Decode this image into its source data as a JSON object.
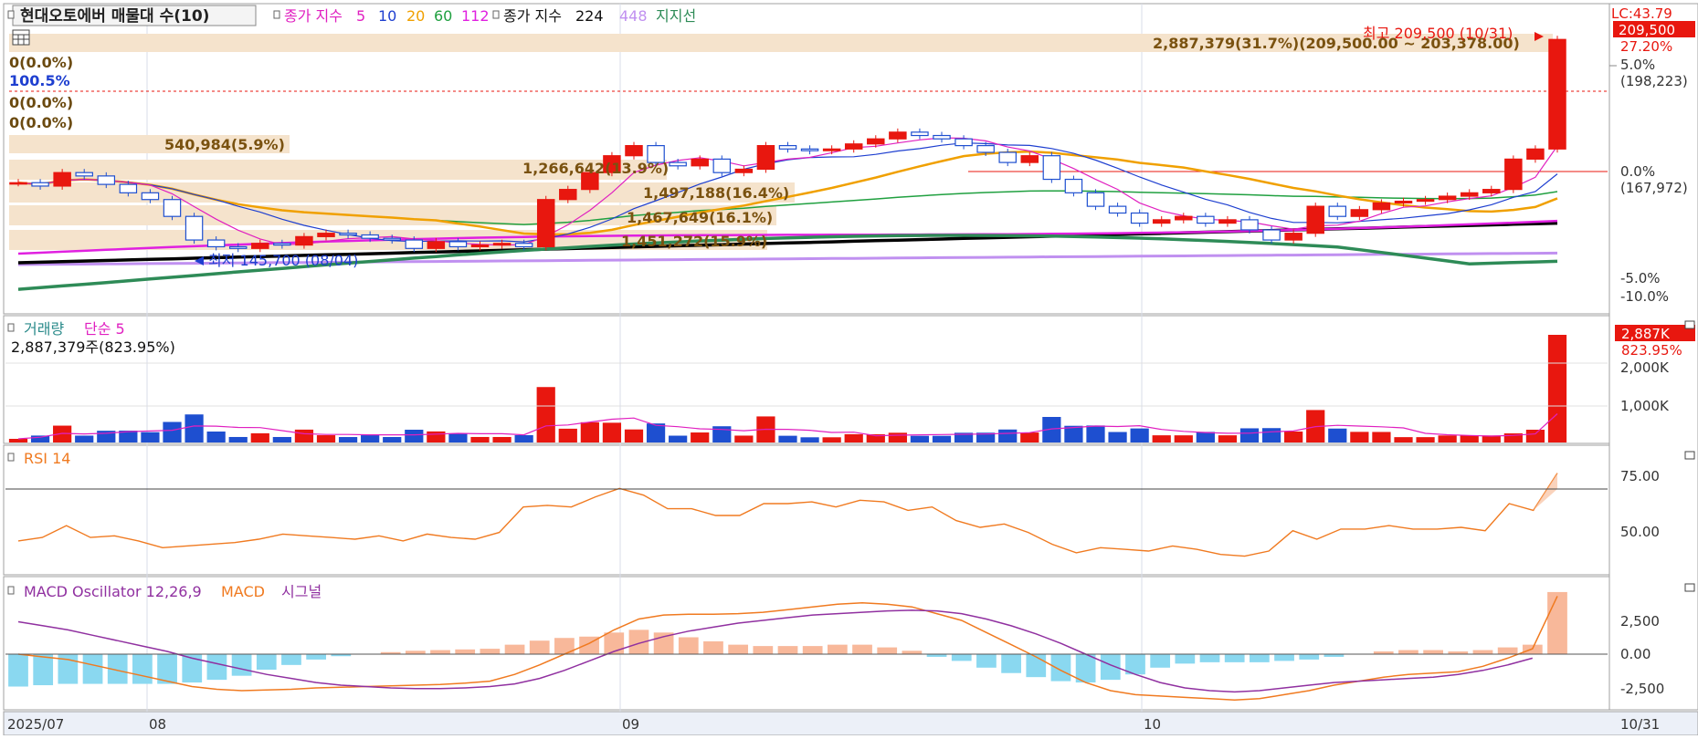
{
  "header": {
    "stock_label": "현대오토에버 매물대 수(10)",
    "close_index_label": "종가 지수",
    "ma_periods": [
      "5",
      "10",
      "20",
      "60",
      "112"
    ],
    "close_index2_label": "종가 지수",
    "ma_long_periods": [
      "224",
      "448"
    ],
    "support_label": "지지선"
  },
  "price_panel": {
    "lc_label": "LC:43.79",
    "current_price_badge": "209,500",
    "change_pct": "27.20%",
    "right_axis": [
      "5.0%",
      "(198,223)",
      "0.0%",
      "(167,972)",
      "-5.0%",
      "-10.0%"
    ],
    "high_marker": "최고 209,500 (10/31)",
    "low_marker": "최저 145,700 (08/04)",
    "zero_rows": [
      "0(0.0%)",
      "100.5%",
      "0(0.0%)",
      "0(0.0%)"
    ],
    "volume_profile_labels": [
      "2,887,379(31.7%)(209,500.00 ~ 203,378.00)",
      "540,984(5.9%)",
      "1,266,642(13.9%)",
      "1,497,188(16.4%)",
      "1,467,649(16.1%)",
      "1,451,272(15.9%)"
    ]
  },
  "volume_panel": {
    "title": "거래량",
    "ma_label": "단순 5",
    "current_volume": "2,887,379주(823.95%)",
    "badge_value": "2,887K",
    "badge_pct": "823.95%",
    "axis": [
      "2,000K",
      "1,000K"
    ]
  },
  "rsi_panel": {
    "title": "RSI 14",
    "axis": [
      "75.00",
      "50.00"
    ]
  },
  "macd_panel": {
    "osc_label": "MACD Oscillator 12,26,9",
    "macd_label": "MACD",
    "signal_label": "시그널",
    "axis": [
      "2,500",
      "0.00",
      "-2,500"
    ]
  },
  "xaxis": {
    "labels": [
      "2025/07",
      "08",
      "09",
      "10",
      "10/31"
    ]
  },
  "colors": {
    "up": "#e8170f",
    "down": "#1e4fd0",
    "ma5": "#e020c0",
    "ma10": "#1e3fd0",
    "ma20": "#f0a000",
    "ma60": "#20a040",
    "ma112": "#e020e0",
    "ma224": "#000000",
    "ma448": "#c090f0",
    "support": "#2e8b57",
    "rsi": "#f07a20",
    "macd": "#f07a20",
    "signal": "#9030a0",
    "osc_pos": "#f8b89a",
    "osc_neg": "#8ad8f0",
    "profile": "#f5e3cc"
  },
  "chart_data": {
    "type": "candlestick",
    "description_series": "daily candles Jul–Oct 2025",
    "closes": [
      167000,
      166000,
      170000,
      169000,
      166500,
      164000,
      162000,
      157000,
      150000,
      148000,
      147500,
      149000,
      148500,
      151000,
      152000,
      151500,
      150500,
      150000,
      147500,
      149500,
      148000,
      148500,
      149000,
      148000,
      162000,
      165000,
      170000,
      175000,
      178000,
      173000,
      172000,
      174000,
      170000,
      171000,
      178000,
      177000,
      176500,
      177000,
      178500,
      180000,
      182000,
      181000,
      180000,
      178000,
      176000,
      173000,
      175000,
      168000,
      164000,
      160000,
      158000,
      155000,
      156000,
      157000,
      155000,
      156000,
      153000,
      150000,
      152000,
      160000,
      157000,
      159000,
      161000,
      161500,
      162000,
      163000,
      164000,
      165000,
      174000,
      177000,
      209500
    ],
    "rsi": [
      40,
      42,
      49,
      42,
      43,
      40,
      36,
      37,
      38,
      39,
      41,
      44,
      43,
      42,
      41,
      43,
      40,
      44,
      42,
      41,
      45,
      60,
      61,
      60,
      66,
      71,
      67,
      59,
      59,
      55,
      55,
      62,
      62,
      63,
      60,
      64,
      63,
      58,
      60,
      52,
      48,
      50,
      45,
      38,
      33,
      36,
      35,
      34,
      37,
      35,
      32,
      31,
      34,
      46,
      41,
      47,
      47,
      49,
      47,
      47,
      48,
      46,
      62,
      58,
      80
    ],
    "macd": [
      0,
      -200,
      -400,
      -800,
      -1200,
      -1600,
      -2000,
      -2400,
      -2600,
      -2700,
      -2650,
      -2600,
      -2500,
      -2450,
      -2400,
      -2350,
      -2300,
      -2250,
      -2150,
      -2000,
      -1500,
      -800,
      0,
      800,
      1800,
      2600,
      2900,
      2950,
      2950,
      3000,
      3100,
      3300,
      3500,
      3700,
      3800,
      3700,
      3500,
      3000,
      2500,
      1600,
      700,
      -200,
      -1200,
      -2100,
      -2700,
      -3000,
      -3100,
      -3200,
      -3300,
      -3400,
      -3300,
      -3000,
      -2700,
      -2300,
      -2000,
      -1700,
      -1500,
      -1400,
      -1300,
      -900,
      -300,
      400,
      4300
    ],
    "signal": [
      2400,
      2100,
      1800,
      1400,
      1000,
      600,
      200,
      -300,
      -700,
      -1100,
      -1500,
      -1800,
      -2100,
      -2300,
      -2400,
      -2500,
      -2550,
      -2550,
      -2500,
      -2400,
      -2200,
      -1800,
      -1200,
      -500,
      200,
      800,
      1300,
      1700,
      2000,
      2300,
      2500,
      2700,
      2900,
      3000,
      3100,
      3200,
      3250,
      3200,
      3000,
      2600,
      2100,
      1500,
      800,
      0,
      -800,
      -1500,
      -2100,
      -2500,
      -2700,
      -2800,
      -2700,
      -2500,
      -2300,
      -2100,
      -2000,
      -1900,
      -1800,
      -1700,
      -1500,
      -1200,
      -800,
      -300
    ]
  }
}
